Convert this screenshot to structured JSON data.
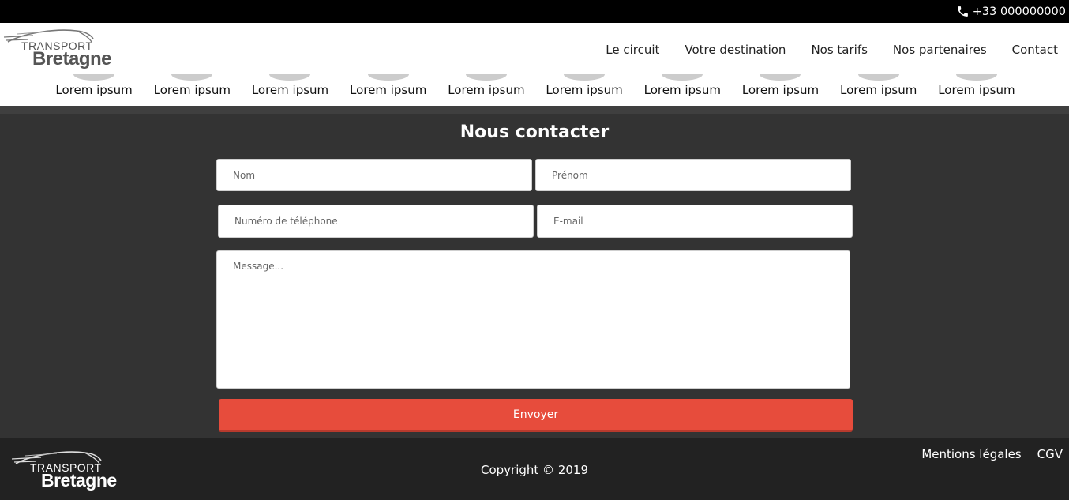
{
  "topbar": {
    "phone_icon": "phone-icon",
    "phone": "+33 000000000"
  },
  "brand": {
    "line1": "TRANSPORT",
    "line2": "Bretagne"
  },
  "nav": {
    "items": [
      "Le circuit",
      "Votre destination",
      "Nos tarifs",
      "Nos partenaires",
      "Contact"
    ]
  },
  "subnav": {
    "items": [
      "Lorem ipsum",
      "Lorem ipsum",
      "Lorem ipsum",
      "Lorem ipsum",
      "Lorem ipsum",
      "Lorem ipsum",
      "Lorem ipsum",
      "Lorem ipsum",
      "Lorem ipsum",
      "Lorem ipsum"
    ]
  },
  "contact": {
    "title": "Nous contacter",
    "nom_placeholder": "Nom",
    "prenom_placeholder": "Prénom",
    "phone_placeholder": "Numéro de téléphone",
    "email_placeholder": "E-mail",
    "message_placeholder": "Message...",
    "submit_label": "Envoyer"
  },
  "footer": {
    "copyright": "Copyright © 2019",
    "links": [
      "Mentions légales",
      "CGV"
    ]
  },
  "colors": {
    "topbar": "#000000",
    "header": "#ffffff",
    "main_bg": "#333333",
    "footer_bg": "#222222",
    "accent": "#e74c3c"
  }
}
